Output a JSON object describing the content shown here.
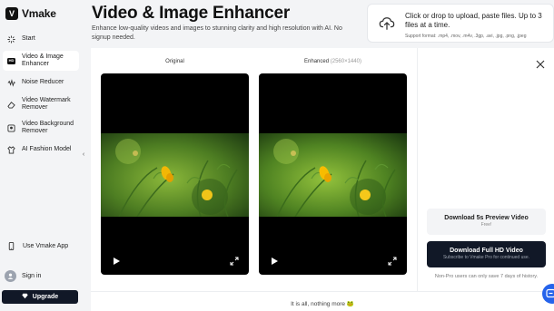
{
  "app": {
    "logo_text": "Vmake",
    "logo_mark": "V"
  },
  "sidebar": {
    "items": [
      {
        "label": "Start",
        "icon": "sparkle-icon",
        "active": false
      },
      {
        "label": "Video & Image Enhancer",
        "icon": "hd-icon",
        "badge": "HD",
        "active": true
      },
      {
        "label": "Noise Reducer",
        "icon": "noise-icon",
        "active": false
      },
      {
        "label": "Video Watermark Remover",
        "icon": "eraser-icon",
        "active": false
      },
      {
        "label": "Video Background Remover",
        "icon": "background-icon",
        "active": false
      },
      {
        "label": "AI Fashion Model",
        "icon": "fashion-icon",
        "active": false
      }
    ],
    "app_link": "Use Vmake App",
    "signin": "Sign in",
    "upgrade": "Upgrade"
  },
  "header": {
    "title": "Video & Image Enhancer",
    "subtitle": "Enhance low-quality videos and images to stunning clarity and high resolution with AI. No signup needed."
  },
  "upload": {
    "text": "Click or drop to upload, paste files. Up to 3 files at a time.",
    "formats": "Support format: .mp4, .mov, .m4v, .3gp, .avi, .jpg, .png, .jpeg"
  },
  "compare": {
    "original_label": "Original",
    "enhanced_label": "Enhanced",
    "enhanced_dims": "(2560×1440)"
  },
  "actions": {
    "preview_main": "Download 5s Preview Video",
    "preview_sub": "Free!",
    "full_main": "Download Full HD Video",
    "full_sub": "Subscribe to Vmake Pro for continued use.",
    "history_note": "Non-Pro users can only save 7 days of history."
  },
  "footer": {
    "end_note": "It is all, nothing more 🐸"
  },
  "colors": {
    "sidebar_bg": "#f3f4f6",
    "dark_button": "#111827",
    "fab": "#2563eb"
  }
}
